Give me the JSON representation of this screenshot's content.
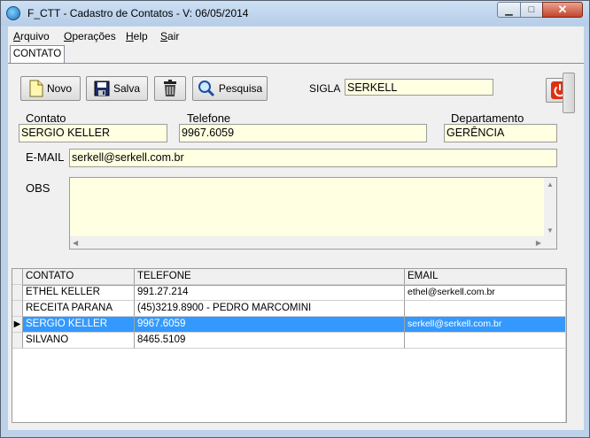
{
  "window": {
    "title": "F_CTT - Cadastro de Contatos - V: 06/05/2014",
    "min_glyph": "▁",
    "max_glyph": "□",
    "close_glyph": "✕"
  },
  "menu": [
    {
      "accel": "A",
      "rest": "rquivo"
    },
    {
      "accel": "O",
      "rest": "perações"
    },
    {
      "accel": "H",
      "rest": "elp"
    },
    {
      "accel": "S",
      "rest": "air"
    }
  ],
  "tab": {
    "label": "CONTATO"
  },
  "toolbar": {
    "novo_label": "Novo",
    "salva_label": "Salva",
    "pesquisa_label": "Pesquisa",
    "icons": [
      "new-document-icon",
      "floppy-disk-icon",
      "trash-icon",
      "magnifier-icon",
      "power-icon"
    ]
  },
  "form": {
    "sigla_label": "SIGLA",
    "sigla_value": "SERKELL",
    "contato_label": "Contato",
    "contato_value": "SERGIO KELLER",
    "telefone_label": "Telefone",
    "telefone_value": "9967.6059",
    "departamento_label": "Departamento",
    "departamento_value": "GERÊNCIA",
    "email_label": "E-MAIL",
    "email_value": "serkell@serkell.com.br",
    "obs_label": "OBS",
    "obs_value": ""
  },
  "grid": {
    "columns": [
      "CONTATO",
      "TELEFONE",
      "EMAIL"
    ],
    "rows": [
      {
        "contato": "ETHEL KELLER",
        "telefone": "991.27.214",
        "email": "ethel@serkell.com.br"
      },
      {
        "contato": "RECEITA PARANA",
        "telefone": "(45)3219.8900 - PEDRO MARCOMINI",
        "email": ""
      },
      {
        "contato": "SERGIO KELLER",
        "telefone": "9967.6059",
        "email": "serkell@serkell.com.br"
      },
      {
        "contato": "SILVANO",
        "telefone": "8465.5109",
        "email": ""
      }
    ],
    "selected_row": 2,
    "current_row_marker": "▶"
  },
  "colors": {
    "field_bg": "#ffffe1",
    "selection": "#3399ff",
    "power_button": "#e03010"
  }
}
